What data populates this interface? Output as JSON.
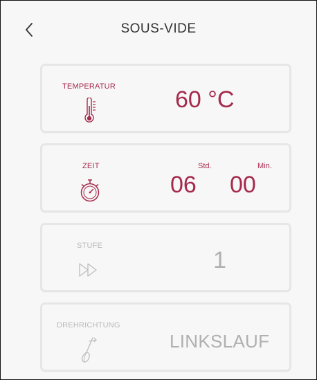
{
  "header": {
    "title": "SOUS-VIDE"
  },
  "temperature": {
    "label": "TEMPERATUR",
    "value": "60 °C"
  },
  "time": {
    "label": "ZEIT",
    "hours": "06",
    "hours_unit": "Std.",
    "minutes": "00",
    "minutes_unit": "Min."
  },
  "level": {
    "label": "STUFE",
    "value": "1"
  },
  "direction": {
    "label": "DREHRICHTUNG",
    "value": "LINKSLAUF"
  },
  "colors": {
    "accent": "#a52a4c",
    "inactive": "#b0b0b0",
    "background": "#f7f7f7",
    "card_border": "#e6e6e6"
  },
  "icons": {
    "back": "chevron-left-icon",
    "temperature": "thermometer-icon",
    "time": "stopwatch-icon",
    "level": "fast-forward-icon",
    "direction": "whisk-icon"
  }
}
